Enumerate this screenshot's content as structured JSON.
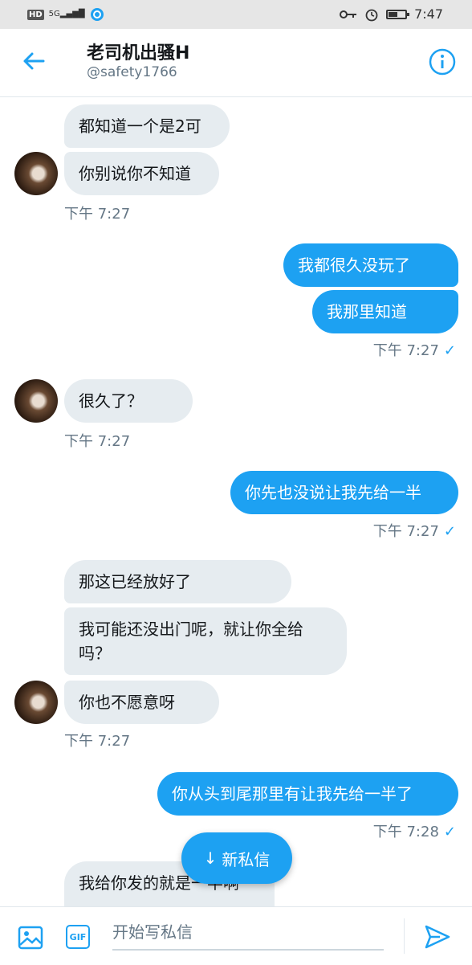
{
  "status_bar": {
    "hd": "HD",
    "network": "5G",
    "time": "7:47",
    "battery_level": 0.55
  },
  "header": {
    "title": "老司机出骚H",
    "handle": "@safety1766"
  },
  "messages": {
    "m1": "都知道一个是2可",
    "m2": "你别说你不知道",
    "t1": "下午 7:27",
    "m3": "我都很久没玩了",
    "m4": "我那里知道",
    "t2": "下午 7:27",
    "m5": "很久了？",
    "t3": "下午 7:27",
    "m6": "你先也没说让我先给一半",
    "t4": "下午 7:27",
    "m7": "那这已经放好了",
    "m8": "我可能还没出门呢，就让你全给吗？",
    "m9": "你也不愿意呀",
    "t5": "下午 7:27",
    "m10": "你从头到尾那里有让我先给一半了",
    "t6": "下午 7:28",
    "m11": "我给你发的就是一半啊"
  },
  "new_message_button": {
    "label": "新私信",
    "arrow": "↓"
  },
  "composer": {
    "placeholder": "开始写私信",
    "gif_label": "GIF"
  },
  "colors": {
    "accent": "#1da1f2",
    "incoming_bubble": "#e6ecf0"
  }
}
